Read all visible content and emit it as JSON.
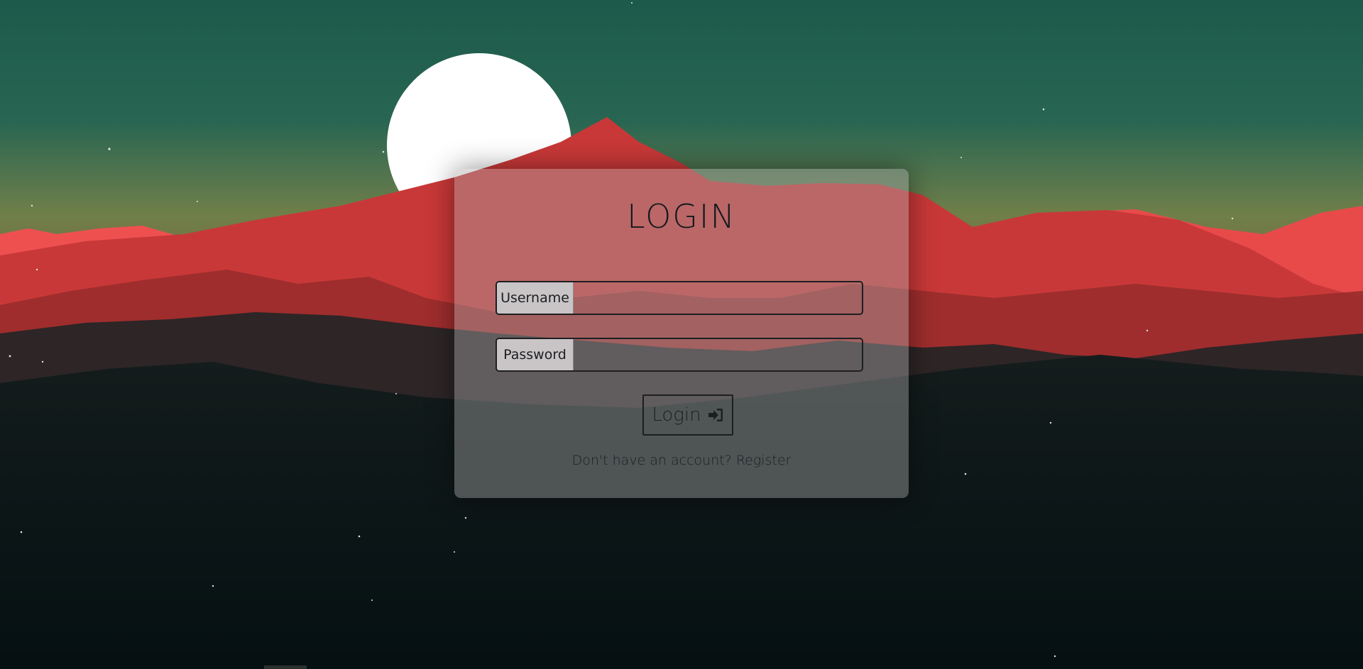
{
  "login": {
    "title": "LOGIN",
    "username_label": "Username",
    "username_value": "",
    "password_label": "Password",
    "password_value": "",
    "button_label": "Login",
    "button_icon": "sign-in-icon",
    "register_prefix": "Don't have an account?",
    "register_link": "Register"
  },
  "colors": {
    "sky_top": "#1d5a4b",
    "sky_horizon": "#6f7f4a",
    "moon": "#ffffff",
    "mountain_red": "#e84a4a",
    "mountain_dark_red": "#c23535",
    "ground_dark": "#0e1616",
    "card_overlay": "#aaaaaa",
    "text_dark": "#1c1f22",
    "label_bg": "#c9c4c6"
  }
}
